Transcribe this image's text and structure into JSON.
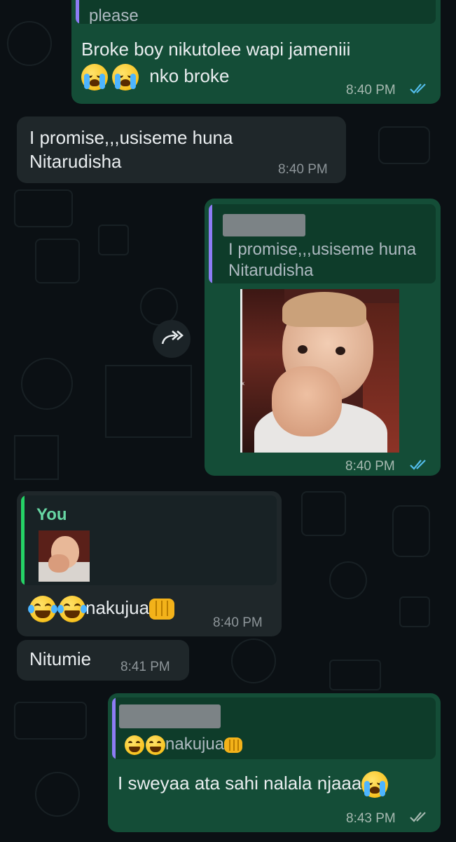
{
  "chat": {
    "colors": {
      "outgoing": "#144d37",
      "incoming": "#1f272a",
      "quote_bar_purple": "#8d7cf5",
      "quote_bar_green": "#25d366",
      "read_ticks": "#53bdeb",
      "sent_ticks": "#a6b9b0"
    },
    "messages": [
      {
        "quote_text": "please",
        "line1": "Broke boy nikutolee wapi jameniii",
        "line2": "nko broke",
        "time": "8:40 PM",
        "status": "read"
      },
      {
        "line1": "I promise,,,usiseme huna",
        "line2": "Nitarudisha",
        "time": "8:40 PM"
      },
      {
        "quote_line1": "I promise,,,usiseme huna",
        "quote_line2": "Nitarudisha",
        "time": "8:40 PM",
        "status": "read",
        "media": "baby-laughing-gif"
      },
      {
        "quote_author": "You",
        "text": "nakujua",
        "time": "8:40 PM"
      },
      {
        "text": "Nitumie",
        "time": "8:41 PM"
      },
      {
        "quote_text": "nakujua",
        "text": "I sweyaa ata sahi nalala njaaa",
        "time": "8:43 PM",
        "status": "delivered"
      }
    ],
    "forward_icon": "forward-icon"
  }
}
